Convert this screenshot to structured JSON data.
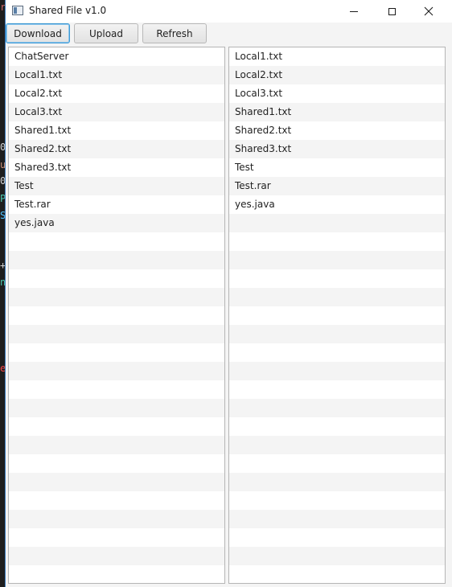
{
  "window": {
    "title": "Shared File v1.0"
  },
  "toolbar": {
    "download_label": "Download",
    "upload_label": "Upload",
    "refresh_label": "Refresh"
  },
  "left_list": {
    "items": [
      "ChatServer",
      "Local1.txt",
      "Local2.txt",
      "Local3.txt",
      "Shared1.txt",
      "Shared2.txt",
      "Shared3.txt",
      "Test",
      "Test.rar",
      "yes.java"
    ]
  },
  "right_list": {
    "items": [
      "Local1.txt",
      "Local2.txt",
      "Local3.txt",
      "Shared1.txt",
      "Shared2.txt",
      "Shared3.txt",
      "Test",
      "Test.rar",
      "yes.java"
    ]
  },
  "colors": {
    "row_alt": "#f4f4f4",
    "focus_border": "#3c9ad6"
  }
}
